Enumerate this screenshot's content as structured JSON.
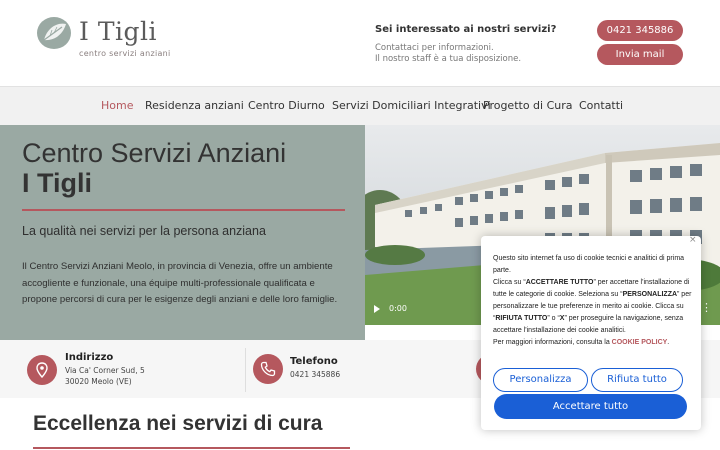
{
  "header": {
    "logo_title": "I Tigli",
    "logo_subtitle": "centro servizi anziani",
    "contact_question": "Sei interessato ai nostri servizi?",
    "contact_line1": "Contattaci per informazioni.",
    "contact_line2": "Il nostro staff è a tua disposizione.",
    "phone_button": "0421 345886",
    "mail_button": "Invia mail"
  },
  "nav": {
    "items": [
      "Home",
      "Residenza anziani",
      "Centro Diurno",
      "Servizi Domiciliari Integrativi",
      "Progetto di Cura",
      "Contatti"
    ],
    "active": "Home"
  },
  "hero": {
    "title_line1": "Centro Servizi Anziani",
    "title_line2": "I Tigli",
    "tagline": "La qualità nei servizi per la persona anziana",
    "description": "Il Centro Servizi Anziani Meolo, in provincia di Venezia, offre un ambiente accogliente e funzionale, una équipe multi-professionale qualificata e propone percorsi di cura per le esigenze degli anziani e delle loro famiglie."
  },
  "video": {
    "time": "0:00"
  },
  "info": {
    "address_label": "Indirizzo",
    "address_line1": "Via Ca' Corner Sud, 5",
    "address_line2": "30020 Meolo (VE)",
    "phone_label": "Telefono",
    "phone_value": "0421 345886"
  },
  "section": {
    "title": "Eccellenza nei servizi di cura"
  },
  "cookie": {
    "p1": "Questo sito internet fa uso di cookie tecnici e analitici di prima parte.",
    "p2a": "Clicca su “",
    "p2b": "ACCETTARE TUTTO",
    "p2c": "” per accettare l'installazione di tutte le categorie di cookie. Seleziona su “",
    "p2d": "PERSONALIZZA",
    "p2e": "” per personalizzare le tue preferenze in merito ai cookie. Clicca su “",
    "p2f": "RIFIUTA TUTTO",
    "p2g": "” o “",
    "p2h": "X",
    "p2i": "” per proseguire la navigazione, senza accettare l'installazione dei cookie analitici.",
    "p3": "Per maggiori informazioni, consulta la ",
    "policy_link": "COOKIE POLICY",
    "p3end": ".",
    "customize_button": "Personalizza",
    "reject_button": "Rifiuta tutto",
    "accept_button": "Accettare tutto",
    "close": "×"
  },
  "colors": {
    "accent": "#b5585e",
    "hero_bg": "#9aa9a3",
    "cookie_blue": "#1a5fd6"
  }
}
